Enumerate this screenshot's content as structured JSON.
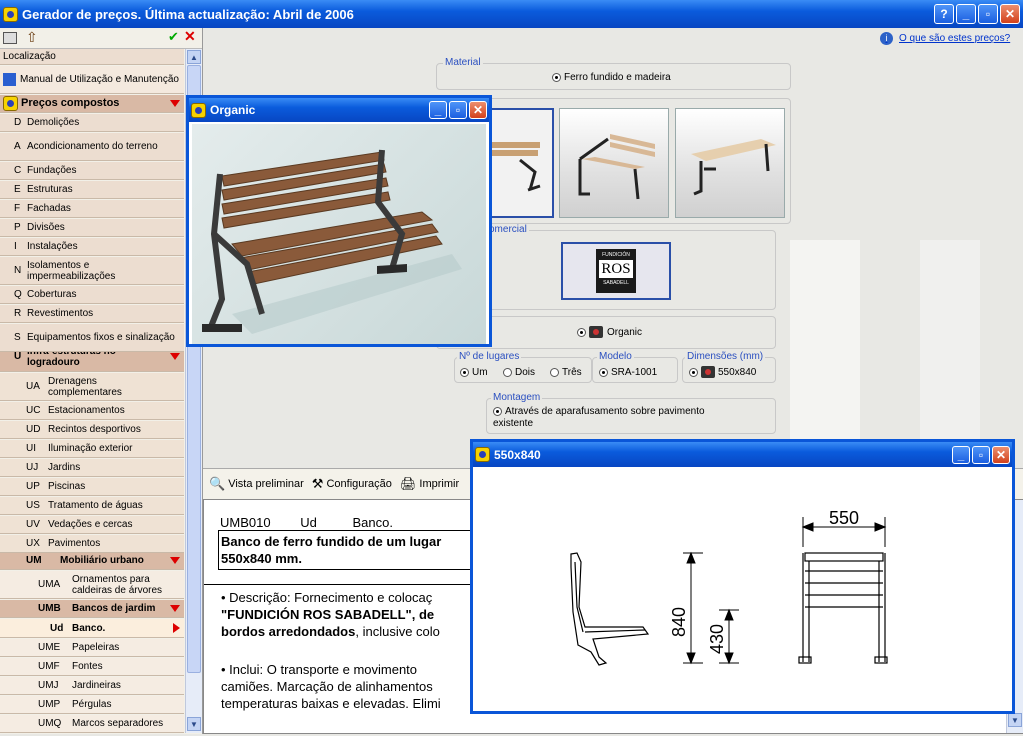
{
  "window": {
    "title": "Gerador de preços. Última actualização: Abril de 2006",
    "help_btn": "?",
    "min_btn": "_",
    "max_btn": "▫",
    "close_btn": "✕"
  },
  "help_link": "O que são estes preços?",
  "sidebar": {
    "localizacao": "Localização",
    "manual": "Manual de Utilização e Manutenção",
    "precos": "Preços compostos",
    "chapters": [
      {
        "code": "D",
        "label": "Demolições"
      },
      {
        "code": "A",
        "label": "Acondicionamento do terreno"
      },
      {
        "code": "C",
        "label": "Fundações"
      },
      {
        "code": "E",
        "label": "Estruturas"
      },
      {
        "code": "F",
        "label": "Fachadas"
      },
      {
        "code": "P",
        "label": "Divisões"
      },
      {
        "code": "I",
        "label": "Instalações"
      },
      {
        "code": "N",
        "label": "Isolamentos e impermeabilizações"
      },
      {
        "code": "Q",
        "label": "Coberturas"
      },
      {
        "code": "R",
        "label": "Revestimentos"
      },
      {
        "code": "S",
        "label": "Equipamentos fixos e sinalização"
      }
    ],
    "u_code": "U",
    "u_label": "Infra-estruturas no logradouro",
    "u_items": [
      {
        "code": "UA",
        "label": "Drenagens complementares"
      },
      {
        "code": "UC",
        "label": "Estacionamentos"
      },
      {
        "code": "UD",
        "label": "Recintos desportivos"
      },
      {
        "code": "UI",
        "label": "Iluminação exterior"
      },
      {
        "code": "UJ",
        "label": "Jardins"
      },
      {
        "code": "UP",
        "label": "Piscinas"
      },
      {
        "code": "US",
        "label": "Tratamento de águas"
      },
      {
        "code": "UV",
        "label": "Vedações e cercas"
      },
      {
        "code": "UX",
        "label": "Pavimentos"
      }
    ],
    "um_code": "UM",
    "um_label": "Mobiliário urbano",
    "um_items_top": [
      {
        "code": "UMA",
        "label": "Ornamentos para caldeiras de árvores"
      }
    ],
    "umb_code": "UMB",
    "umb_label": "Bancos de jardim",
    "ud_code": "Ud",
    "ud_label": "Banco.",
    "um_items_bottom": [
      {
        "code": "UME",
        "label": "Papeleiras"
      },
      {
        "code": "UMF",
        "label": "Fontes"
      },
      {
        "code": "UMJ",
        "label": "Jardineiras"
      },
      {
        "code": "UMP",
        "label": "Pérgulas"
      },
      {
        "code": "UMQ",
        "label": "Marcos separadores"
      }
    ]
  },
  "material": {
    "legend": "Material",
    "option": "Ferro fundido e madeira"
  },
  "comercial_legend": "omercial",
  "ros_logo": {
    "top": "FUNDICIÓN",
    "mid": "ROS",
    "bottom": "SABADELL"
  },
  "organic_option": "Organic",
  "lugares": {
    "legend": "Nº de lugares",
    "um": "Um",
    "dois": "Dois",
    "tres": "Três"
  },
  "modelo": {
    "legend": "Modelo",
    "value": "SRA-1001"
  },
  "dimensoes": {
    "legend": "Dimensões (mm)",
    "value": "550x840"
  },
  "montagem": {
    "legend": "Montagem",
    "option": "Através de aparafusamento sobre pavimento existente"
  },
  "toolbar": {
    "preview": "Vista preliminar",
    "config": "Configuração",
    "print": "Imprimir"
  },
  "doc": {
    "code": "UMB010",
    "unit": "Ud",
    "name": "Banco.",
    "title_l1": "Banco de ferro fundido de um lugar",
    "title_l2": "550x840 mm.",
    "desc_l1": "• Descrição: Fornecimento e colocaç",
    "desc_l2": "\"FUNDICIÓN ROS SABADELL\", de",
    "desc_l3_b": "bordos arredondados",
    "desc_l3": ", inclusive colo",
    "incl_l1": "• Inclui: O transporte e movimento",
    "incl_l2": "camiões. Marcação de alinhamentos",
    "incl_l3": "temperaturas baixas e elevadas. Elimi"
  },
  "popup_organic": {
    "title": "Organic"
  },
  "popup_dim": {
    "title": "550x840",
    "w": "550",
    "h": "840",
    "seat": "430"
  }
}
